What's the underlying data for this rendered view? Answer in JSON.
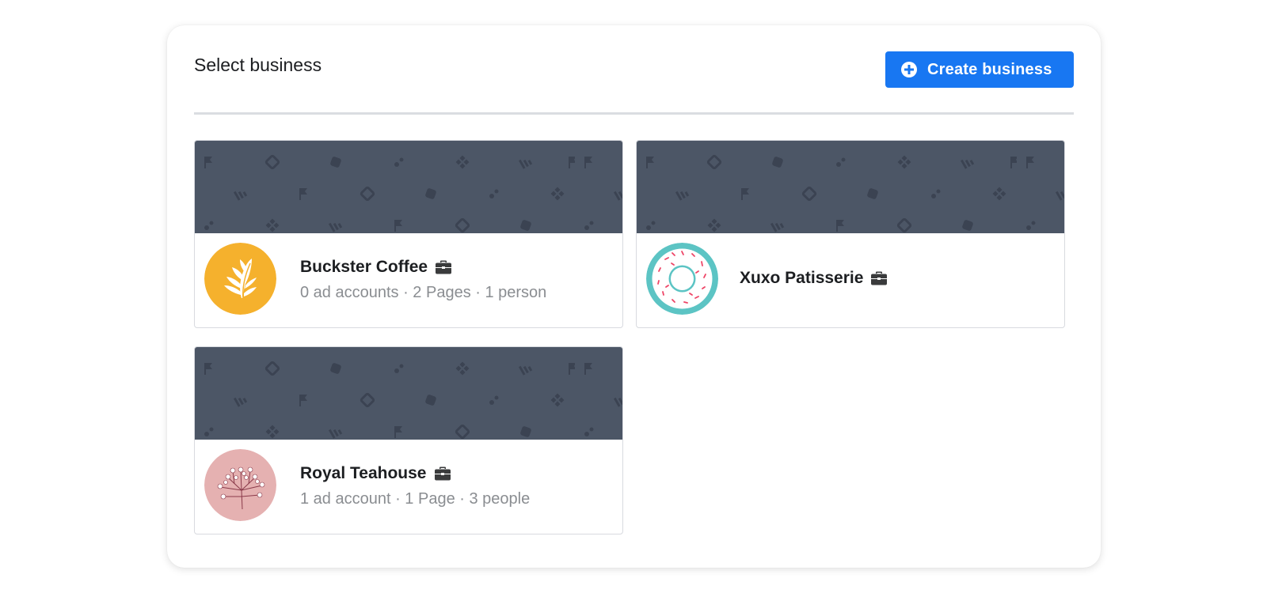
{
  "header": {
    "title": "Select business",
    "create_button_label": "Create business"
  },
  "businesses": [
    {
      "name": "Buckster Coffee",
      "meta": "0 ad accounts · 2 Pages · 1 person",
      "avatar_icon": "latte-art-leaf-icon",
      "avatar_color": "#f5b12d"
    },
    {
      "name": "Xuxo Patisserie",
      "meta": "",
      "avatar_icon": "donut-icon",
      "avatar_color": "#5cc4c4"
    },
    {
      "name": "Royal Teahouse",
      "meta": "1 ad account · 1 Page · 3 people",
      "avatar_icon": "blossom-branch-icon",
      "avatar_color": "#e5b1b1"
    }
  ],
  "colors": {
    "accent": "#1877f2",
    "banner": "#4c5666",
    "divider": "#dadde1"
  }
}
